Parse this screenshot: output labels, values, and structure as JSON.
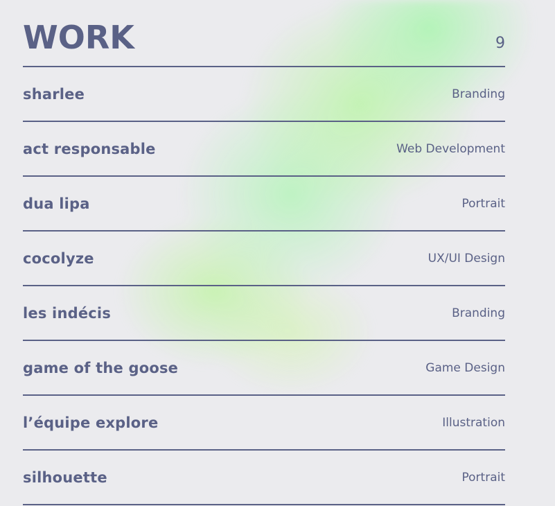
{
  "header": {
    "title": "WORK",
    "count": "9"
  },
  "work": {
    "items": [
      {
        "name": "sharlee",
        "category": "Branding"
      },
      {
        "name": "act responsable",
        "category": "Web Development"
      },
      {
        "name": "dua lipa",
        "category": "Portrait"
      },
      {
        "name": "cocolyze",
        "category": "UX/UI Design"
      },
      {
        "name": "les indécis",
        "category": "Branding"
      },
      {
        "name": "game of the goose",
        "category": "Game Design"
      },
      {
        "name": "l’équipe explore",
        "category": "Illustration"
      },
      {
        "name": "silhouette",
        "category": "Portrait"
      }
    ]
  },
  "colors": {
    "text": "#5a6186",
    "background": "#ebebee",
    "accent_glow": "#b4f5b0"
  }
}
